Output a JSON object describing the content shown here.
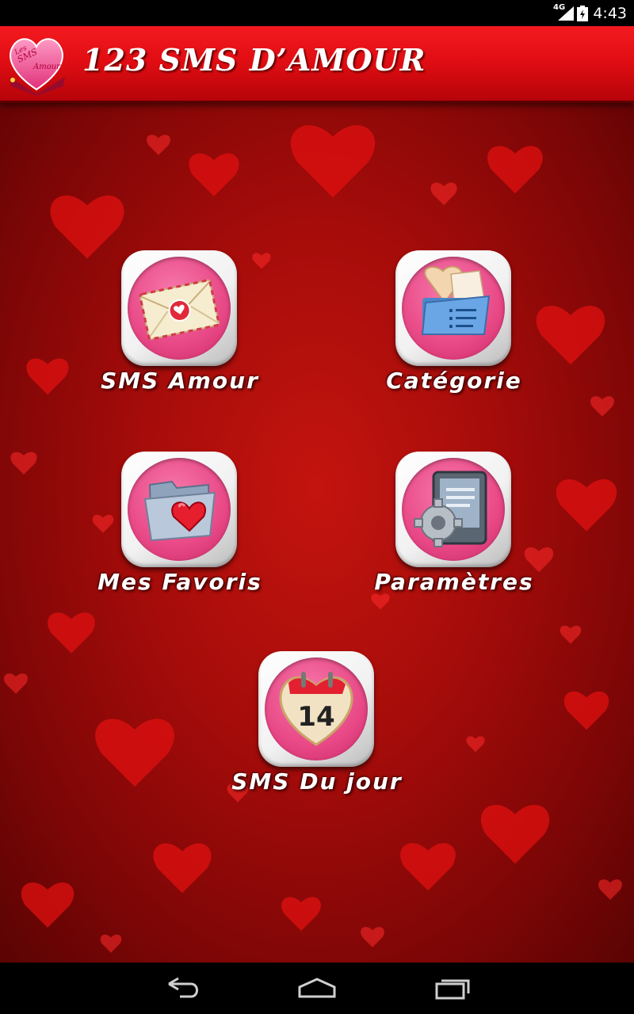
{
  "status_bar": {
    "network": "4G",
    "time": "4:43",
    "icons": [
      "signal-icon",
      "battery-icon"
    ]
  },
  "action_bar": {
    "title": "123 SMS D’AMOUR",
    "logo": "love-sms-box-logo",
    "logo_lettering": "Les SMS Amour"
  },
  "menu": {
    "items": [
      {
        "label": "SMS Amour",
        "icon": "love-letter-icon"
      },
      {
        "label": "Catégorie",
        "icon": "category-folder-icon"
      },
      {
        "label": "Mes Favoris",
        "icon": "favorites-folder-icon"
      },
      {
        "label": "Paramètres",
        "icon": "settings-gear-icon"
      },
      {
        "label": "SMS Du jour",
        "icon": "calendar-icon",
        "calendar_day": "14"
      }
    ]
  },
  "navigation": {
    "buttons": [
      "back-icon",
      "home-icon",
      "recent-apps-icon"
    ]
  },
  "colors": {
    "action_bar": "#e20e14",
    "background": "#a50c0a",
    "tile_disc": "#e84886",
    "label_text": "#ffffff"
  }
}
